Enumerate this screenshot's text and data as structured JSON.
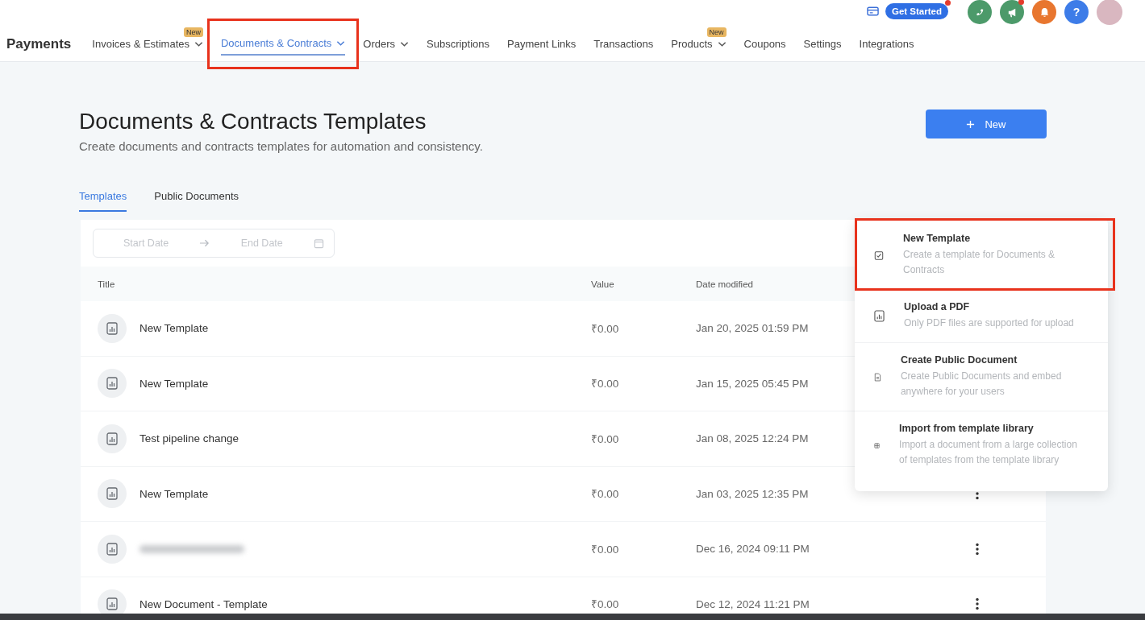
{
  "app_title": "Payments",
  "top_actions": {
    "get_started": "Get Started",
    "get_started_dot": true,
    "help": "?",
    "icons": [
      {
        "kind": "phone",
        "color": "#4c9a6a",
        "dot": false
      },
      {
        "kind": "megaphone",
        "color": "#4c9a6a",
        "dot": true
      },
      {
        "kind": "bell",
        "color": "#e8762f",
        "dot": false
      }
    ]
  },
  "nav": [
    {
      "label": "Invoices & Estimates",
      "selected": false,
      "dropdown": true,
      "badge": "New"
    },
    {
      "label": "Documents & Contracts",
      "selected": true,
      "dropdown": true,
      "annotated": true
    },
    {
      "label": "Orders",
      "selected": false,
      "dropdown": true
    },
    {
      "label": "Subscriptions",
      "selected": false,
      "dropdown": false
    },
    {
      "label": "Payment Links",
      "selected": false,
      "dropdown": false
    },
    {
      "label": "Transactions",
      "selected": false,
      "dropdown": false
    },
    {
      "label": "Products",
      "selected": false,
      "dropdown": true,
      "badge": "New"
    },
    {
      "label": "Coupons",
      "selected": false,
      "dropdown": false
    },
    {
      "label": "Settings",
      "selected": false,
      "dropdown": false
    },
    {
      "label": "Integrations",
      "selected": false,
      "dropdown": false
    }
  ],
  "page": {
    "title": "Documents & Contracts Templates",
    "subtitle": "Create documents and contracts templates for automation and consistency.",
    "new_button": "New"
  },
  "tabs": [
    {
      "label": "Templates",
      "selected": true
    },
    {
      "label": "Public Documents",
      "selected": false
    }
  ],
  "filter": {
    "start_placeholder": "Start Date",
    "end_placeholder": "End Date"
  },
  "table": {
    "columns": [
      "Title",
      "Value",
      "Date modified"
    ],
    "rows": [
      {
        "title": "New Template",
        "redacted": false,
        "value": "₹0.00",
        "date": "Jan 20, 2025 01:59 PM"
      },
      {
        "title": "New Template",
        "redacted": false,
        "value": "₹0.00",
        "date": "Jan 15, 2025 05:45 PM"
      },
      {
        "title": "Test pipeline change",
        "redacted": false,
        "value": "₹0.00",
        "date": "Jan 08, 2025 12:24 PM"
      },
      {
        "title": "New Template",
        "redacted": false,
        "value": "₹0.00",
        "date": "Jan 03, 2025 12:35 PM"
      },
      {
        "redacted": true,
        "value": "₹0.00",
        "date": "Dec 16, 2024 09:11 PM"
      },
      {
        "title": "New Document  -  Template",
        "redacted": false,
        "value": "₹0.00",
        "date": "Dec 12, 2024 11:21 PM"
      }
    ]
  },
  "new_menu": [
    {
      "kind": "template",
      "title": "New Template",
      "description": "Create a template for Documents & Contracts",
      "annotated": true
    },
    {
      "kind": "pdf",
      "title": "Upload a PDF",
      "description": "Only PDF files are supported for upload",
      "annotated": false
    },
    {
      "kind": "public",
      "title": "Create Public Document",
      "description": "Create Public Documents and embed anywhere for your users",
      "annotated": false
    },
    {
      "kind": "library",
      "title": "Import from template library",
      "description": "Import a document from a large collection of templates from the template library",
      "annotated": false
    }
  ]
}
